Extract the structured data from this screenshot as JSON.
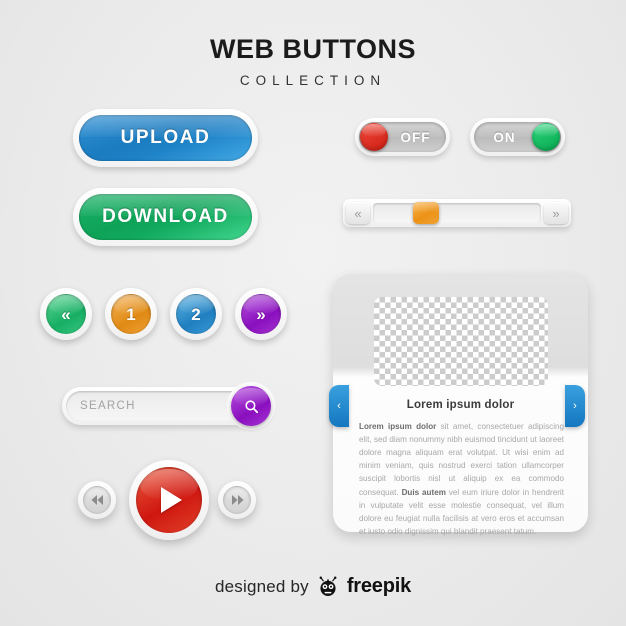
{
  "header": {
    "title": "WEB BUTTONS",
    "subtitle": "COLLECTION"
  },
  "colors": {
    "upload_blue": "#1c7cc0",
    "download_green": "#0ea257",
    "orange": "#e08a15",
    "purple": "#8a0fbe",
    "red": "#cf1710",
    "card_blue": "#1477c0",
    "background": "#ebebeb"
  },
  "buttons": {
    "upload_label": "UPLOAD",
    "download_label": "DOWNLOAD"
  },
  "toggles": [
    {
      "label": "OFF",
      "state": "off",
      "knob_color": "#cf1d12"
    },
    {
      "label": "ON",
      "state": "on",
      "knob_color": "#07a94e"
    }
  ],
  "scrollbar": {
    "prev_icon": "«",
    "next_icon": "»",
    "thumb_position_percent": 24
  },
  "pagination": [
    {
      "label": "«",
      "name": "prev",
      "color": "#17ae63"
    },
    {
      "label": "1",
      "name": "page-1",
      "color": "#e08a15"
    },
    {
      "label": "2",
      "name": "page-2",
      "color": "#1f7fc0"
    },
    {
      "label": "»",
      "name": "next",
      "color": "#8a0fbe"
    }
  ],
  "search": {
    "placeholder": "SEARCH",
    "value": "",
    "button_icon": "search-icon"
  },
  "media": {
    "prev_icon": "◀◀",
    "play_icon": "▶",
    "next_icon": "▶▶"
  },
  "card": {
    "image_placeholder": "checkerboard-transparent",
    "title": "Lorem ipsum dolor",
    "body_lead": "Lorem ipsum dolor",
    "body_text_1": " sit amet, consectetuer adipiscing elit, sed diam nonummy nibh euismod tincidunt ut laoreet dolore magna aliquam erat volutpat. Ut wisi enim ad minim veniam, quis nostrud exerci tation ullamcorper suscipit lobortis nisl ut aliquip ex ea commodo consequat. ",
    "body_bold_2": "Duis autem",
    "body_text_2": " vel eum iriure dolor in hendrerit in vulputate velit esse molestie consequat, vel illum dolore eu feugiat nulla facilisis at vero eros et accumsan et iusto odio dignissim qui blandit praesent tatum.",
    "prev_icon": "‹",
    "next_icon": "›"
  },
  "footer": {
    "designed_by": "designed by",
    "brand": "freepik",
    "logo": "freepik-mascot-icon"
  }
}
